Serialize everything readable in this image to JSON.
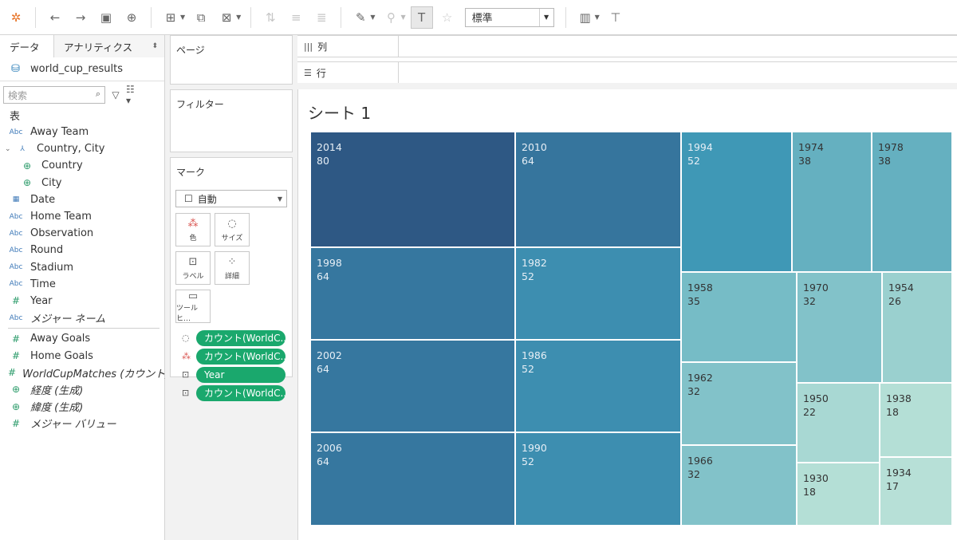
{
  "toolbar": {
    "fit_select_value": "標準",
    "icons": [
      "tableau-logo-icon",
      "undo-icon",
      "redo-icon",
      "save-icon",
      "new-datasource-icon",
      "new-worksheet-icon",
      "duplicate-sheet-icon",
      "clear-sheet-icon",
      "swap-icon",
      "sort-asc-icon",
      "sort-desc-icon",
      "highlight-icon",
      "group-icon",
      "label-toggle-icon",
      "pin-icon",
      "show-me-icon",
      "presentation-icon"
    ]
  },
  "data_pane": {
    "tab_data": "データ",
    "tab_analytics": "アナリティクス",
    "datasource": "world_cup_results",
    "search_placeholder": "検索",
    "table_header": "表",
    "dimensions": [
      {
        "label": "Away Team",
        "type": "Abc",
        "italic": false
      },
      {
        "label": "Country, City",
        "type": "hierarchy",
        "italic": false
      },
      {
        "label": "Country",
        "type": "geo",
        "italic": false
      },
      {
        "label": "City",
        "type": "geo",
        "italic": false
      },
      {
        "label": "Date",
        "type": "date",
        "italic": false
      },
      {
        "label": "Home Team",
        "type": "Abc",
        "italic": false
      },
      {
        "label": "Observation",
        "type": "Abc",
        "italic": false
      },
      {
        "label": "Round",
        "type": "Abc",
        "italic": false
      },
      {
        "label": "Stadium",
        "type": "Abc",
        "italic": false
      },
      {
        "label": "Time",
        "type": "Abc",
        "italic": false
      },
      {
        "label": "Year",
        "type": "num",
        "italic": false
      },
      {
        "label": "メジャー ネーム",
        "type": "Abc",
        "italic": true
      }
    ],
    "measures": [
      {
        "label": "Away Goals",
        "type": "num"
      },
      {
        "label": "Home Goals",
        "type": "num"
      },
      {
        "label": "WorldCupMatches (カウント)",
        "type": "num"
      },
      {
        "label": "経度 (生成)",
        "type": "geo"
      },
      {
        "label": "緯度 (生成)",
        "type": "geo"
      },
      {
        "label": "メジャー バリュー",
        "type": "num"
      }
    ]
  },
  "cards": {
    "pages": "ページ",
    "filters": "フィルター",
    "marks": "マーク",
    "mark_type": "自動",
    "buttons": [
      {
        "label": "色",
        "icon": "color-icon"
      },
      {
        "label": "サイズ",
        "icon": "size-icon"
      },
      {
        "label": "ラベル",
        "icon": "label-icon"
      },
      {
        "label": "詳細",
        "icon": "detail-icon"
      },
      {
        "label": "ツールヒ…",
        "icon": "tooltip-icon"
      }
    ],
    "pills": [
      {
        "label": "カウント(WorldC..",
        "encoding": "size-icon"
      },
      {
        "label": "カウント(WorldC..",
        "encoding": "color-icon"
      },
      {
        "label": "Year",
        "encoding": "label-icon"
      },
      {
        "label": "カウント(WorldC..",
        "encoding": "label-icon"
      }
    ]
  },
  "shelves": {
    "columns": "列",
    "rows": "行"
  },
  "sheet_title": "シート 1",
  "chart_data": {
    "type": "treemap",
    "size_measure": "カウント(WorldCupMatches)",
    "color_measure": "カウント(WorldCupMatches)",
    "label_field": "Year",
    "items": [
      {
        "year": "2014",
        "value": 80,
        "color": "#2e5884"
      },
      {
        "year": "2010",
        "value": 64,
        "color": "#36759d"
      },
      {
        "year": "1998",
        "value": 64,
        "color": "#36779f"
      },
      {
        "year": "2002",
        "value": 64,
        "color": "#36779f"
      },
      {
        "year": "2006",
        "value": 64,
        "color": "#36779f"
      },
      {
        "year": "1982",
        "value": 52,
        "color": "#3d8eb0"
      },
      {
        "year": "1986",
        "value": 52,
        "color": "#3d8eb0"
      },
      {
        "year": "1990",
        "value": 52,
        "color": "#3d8eb0"
      },
      {
        "year": "1994",
        "value": 52,
        "color": "#3f98b6"
      },
      {
        "year": "1974",
        "value": 38,
        "color": "#65b0c0"
      },
      {
        "year": "1978",
        "value": 38,
        "color": "#65b0c0"
      },
      {
        "year": "1958",
        "value": 35,
        "color": "#76bcc6"
      },
      {
        "year": "1970",
        "value": 32,
        "color": "#82c2c9"
      },
      {
        "year": "1962",
        "value": 32,
        "color": "#82c2c9"
      },
      {
        "year": "1966",
        "value": 32,
        "color": "#82c2c9"
      },
      {
        "year": "1954",
        "value": 26,
        "color": "#9ad0cf"
      },
      {
        "year": "1950",
        "value": 22,
        "color": "#a8d8d3"
      },
      {
        "year": "1938",
        "value": 18,
        "color": "#b4dfd6"
      },
      {
        "year": "1930",
        "value": 18,
        "color": "#b4dfd6"
      },
      {
        "year": "1934",
        "value": 17,
        "color": "#b7e0d7"
      }
    ]
  }
}
